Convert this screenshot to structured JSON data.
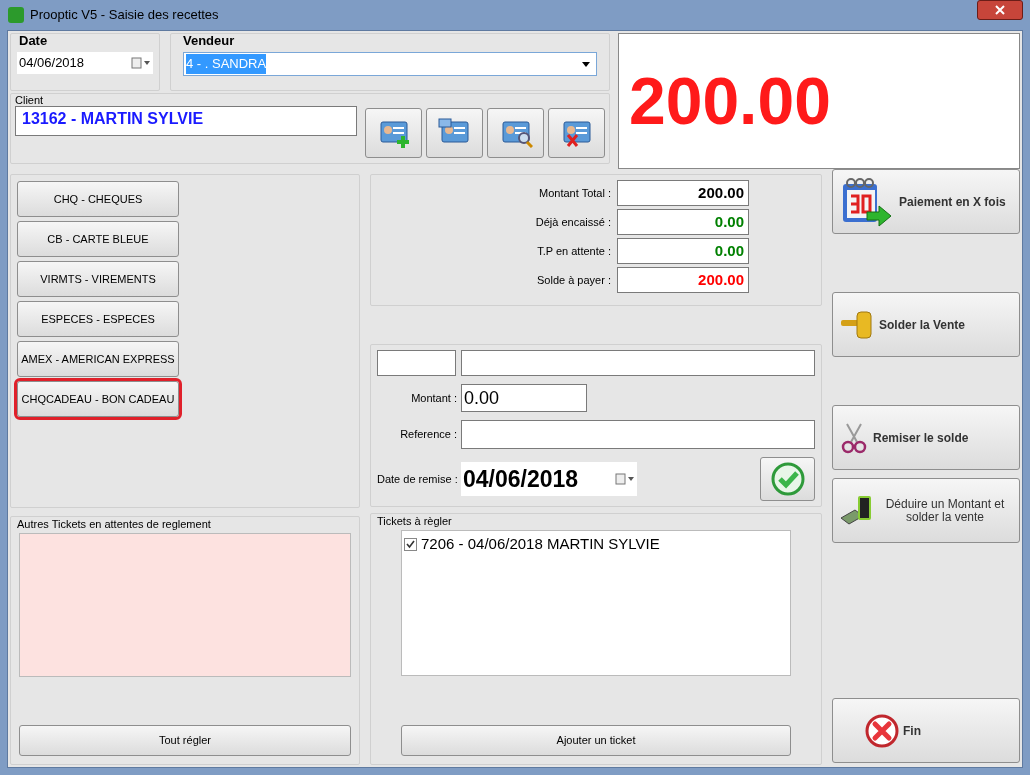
{
  "window": {
    "title": "Prooptic V5 - Saisie des recettes"
  },
  "date": {
    "label": "Date",
    "value": "04/06/2018"
  },
  "vendeur": {
    "label": "Vendeur",
    "value": "4 - . SANDRA"
  },
  "client": {
    "label": "Client",
    "value": "13162 - MARTIN SYLVIE"
  },
  "amount_display": "200.00",
  "payment_methods": [
    {
      "label": "CHQ - CHEQUES",
      "selected": false
    },
    {
      "label": "CB - CARTE BLEUE",
      "selected": false
    },
    {
      "label": "VIRMTS - VIREMENTS",
      "selected": false
    },
    {
      "label": "ESPECES - ESPECES",
      "selected": false
    },
    {
      "label": "AMEX - AMERICAN EXPRESS",
      "selected": false
    },
    {
      "label": "CHQCADEAU - BON CADEAU",
      "selected": true
    }
  ],
  "totals": [
    {
      "label": "Montant Total :",
      "value": "200.00",
      "color": "#000000"
    },
    {
      "label": "Déjà encaissé :",
      "value": "0.00",
      "color": "#008000"
    },
    {
      "label": "T.P en attente :",
      "value": "0.00",
      "color": "#008000"
    },
    {
      "label": "Solde à payer :",
      "value": "200.00",
      "color": "#ff0000"
    }
  ],
  "entry": {
    "montant": {
      "label": "Montant :",
      "value": "0.00"
    },
    "reference": {
      "label": "Reference :"
    },
    "date_remise": {
      "label": "Date de remise :",
      "value": "04/06/2018"
    }
  },
  "autres_tickets": {
    "title": "Autres Tickets en attentes de reglement",
    "button": "Tout régler"
  },
  "tickets": {
    "title": "Tickets à règler",
    "items": [
      {
        "label": "7206 - 04/06/2018 MARTIN SYLVIE",
        "checked": true
      }
    ],
    "button": "Ajouter un ticket"
  },
  "actions": [
    {
      "kind": "calendar",
      "label": "Paiement en X fois"
    },
    {
      "kind": "gavel",
      "label": "Solder la Vente"
    },
    {
      "kind": "scissors",
      "label": "Remiser le solde"
    },
    {
      "kind": "money",
      "label": "Déduire un Montant et solder la vente"
    },
    {
      "kind": "close",
      "label": "Fin"
    }
  ]
}
